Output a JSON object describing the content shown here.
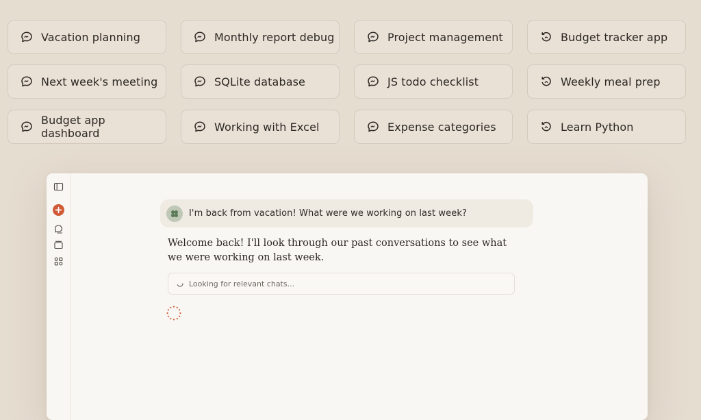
{
  "chats": [
    {
      "label": "Vacation planning",
      "icon": "chat-bubble-icon"
    },
    {
      "label": "Monthly report debug",
      "icon": "chat-bubble-icon"
    },
    {
      "label": "Project management",
      "icon": "chat-bubble-icon"
    },
    {
      "label": "Budget tracker app",
      "icon": "history-icon"
    },
    {
      "label": "Next week's meeting",
      "icon": "chat-bubble-icon"
    },
    {
      "label": "SQLite database",
      "icon": "chat-bubble-icon"
    },
    {
      "label": "JS todo checklist",
      "icon": "chat-bubble-icon"
    },
    {
      "label": "Weekly meal prep",
      "icon": "history-icon"
    },
    {
      "label": "Budget app dashboard",
      "icon": "chat-bubble-icon"
    },
    {
      "label": "Working with Excel",
      "icon": "chat-bubble-icon"
    },
    {
      "label": "Expense categories",
      "icon": "chat-bubble-icon"
    },
    {
      "label": "Learn Python",
      "icon": "history-icon"
    }
  ],
  "sidebar": {
    "icons": [
      "sidebar-toggle-icon",
      "new-chat-icon",
      "chats-icon",
      "projects-icon",
      "artifacts-icon"
    ]
  },
  "conversation": {
    "user_message": "I'm back from vacation! What were we working on last week?",
    "assistant_reply": "Welcome back! I'll look through our past conversations to see what we were working on last week.",
    "tool_status": "Looking for relevant chats..."
  },
  "colors": {
    "background": "#e6ddd1",
    "accent": "#d05a38",
    "window": "#f9f7f3"
  }
}
